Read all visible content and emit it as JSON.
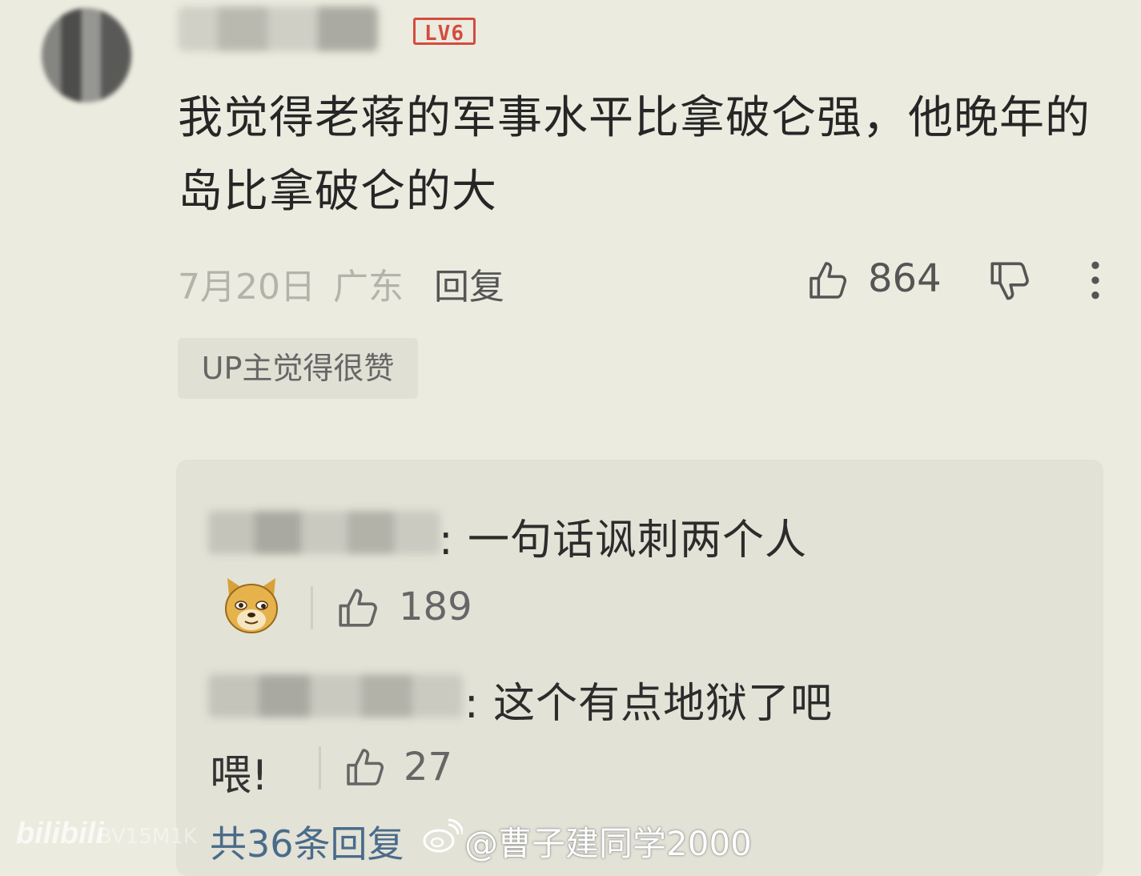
{
  "comment": {
    "level_badge": "LV6",
    "text": "我觉得老蒋的军事水平比拿破仑强，他晚年的岛比拿破仑的大",
    "date": "7月20日",
    "location": "广东",
    "reply_label": "回复",
    "like_count": "864",
    "up_tag": "UP主觉得很赞"
  },
  "replies": [
    {
      "text": ": 一句话讽刺两个人",
      "emoji": "doge-emoji",
      "like_count": "189"
    },
    {
      "text": ": 这个有点地狱了吧",
      "extra_text": "喂!",
      "like_count": "27"
    }
  ],
  "total_replies_label": "共36条回复",
  "watermark": {
    "bilibili": "bilibili",
    "sub": "BV15M1K",
    "weibo_handle": "@曹子建同学2000"
  },
  "colors": {
    "background": "#ebebdf",
    "level_badge": "#d44c3f",
    "link_blue": "#4a6b8a"
  }
}
